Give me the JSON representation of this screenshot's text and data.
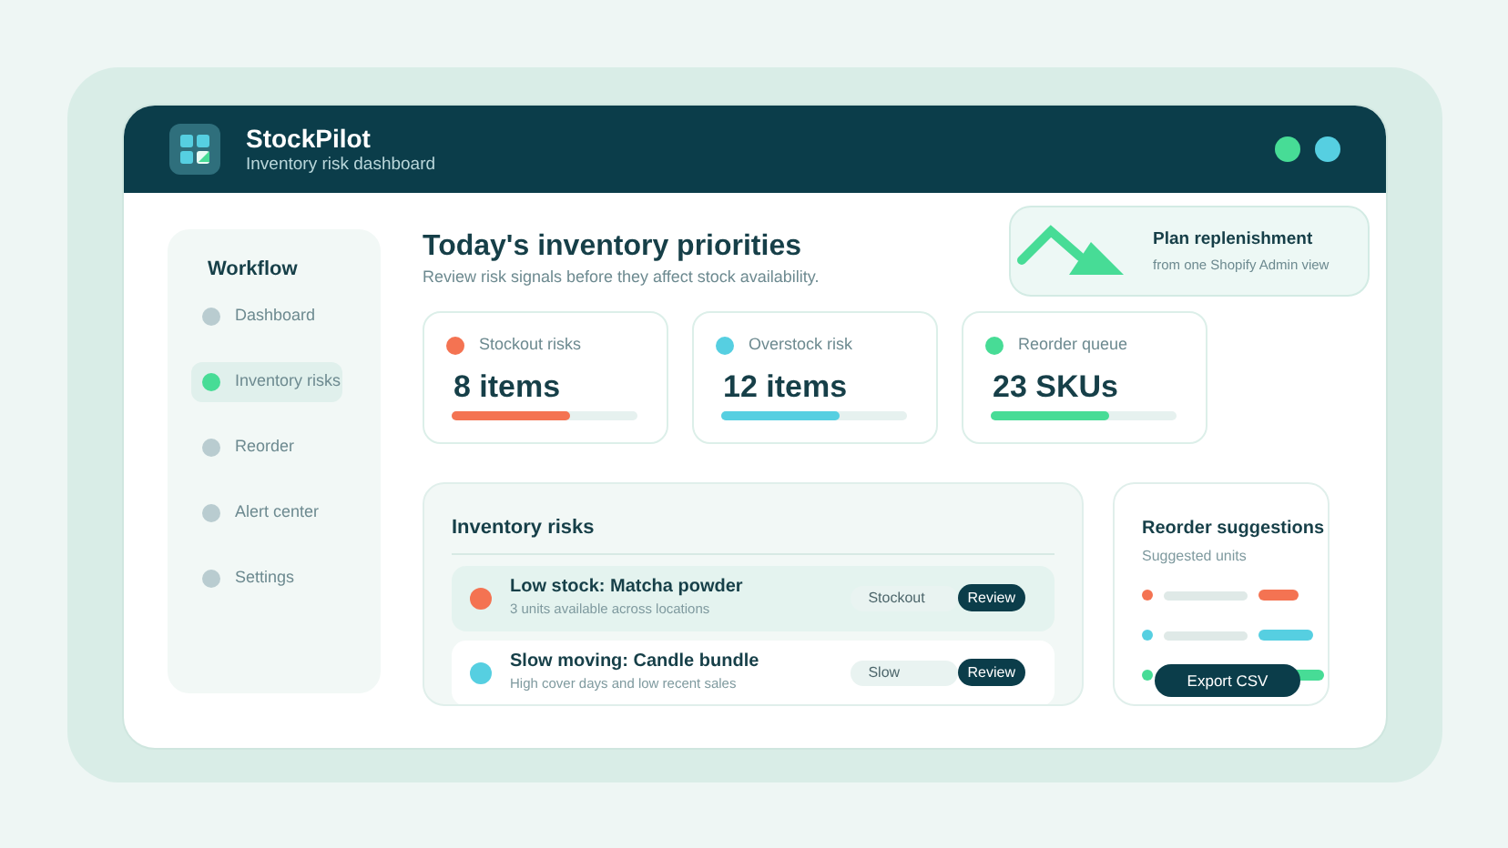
{
  "app": {
    "name": "StockPilot",
    "subtitle": "Inventory risk dashboard"
  },
  "sidebar": {
    "title": "Workflow",
    "items": [
      {
        "label": "Dashboard",
        "selected": false
      },
      {
        "label": "Inventory risks",
        "selected": true
      },
      {
        "label": "Reorder",
        "selected": false
      },
      {
        "label": "Alert center",
        "selected": false
      },
      {
        "label": "Settings",
        "selected": false
      }
    ]
  },
  "header": {
    "title": "Today's inventory priorities",
    "subtitle": "Review risk signals before they affect stock availability."
  },
  "promo": {
    "title": "Plan replenishment",
    "subtitle": "from one Shopify Admin view"
  },
  "stats": [
    {
      "label": "Stockout risks",
      "value": "8 items",
      "color": "#f47352",
      "level": 0.64
    },
    {
      "label": "Overstock risk",
      "value": "12 items",
      "color": "#56cfe1",
      "level": 0.64
    },
    {
      "label": "Reorder queue",
      "value": "23 SKUs",
      "color": "#47dc96",
      "level": 0.64
    }
  ],
  "risks": {
    "title": "Inventory risks",
    "rows": [
      {
        "title": "Low stock: Matcha powder",
        "detail": "3 units available across locations",
        "tag": "Stockout",
        "action": "Review",
        "color": "#f47352",
        "selected": true
      },
      {
        "title": "Slow moving: Candle bundle",
        "detail": "High cover days and low recent sales",
        "tag": "Slow",
        "action": "Review",
        "color": "#56cfe1",
        "selected": false
      }
    ]
  },
  "suggestions": {
    "title": "Reorder suggestions",
    "subtitle": "Suggested units",
    "rows": [
      {
        "color": "#f47352"
      },
      {
        "color": "#56cfe1"
      },
      {
        "color": "#47dc96"
      }
    ],
    "button": "Export CSV"
  }
}
